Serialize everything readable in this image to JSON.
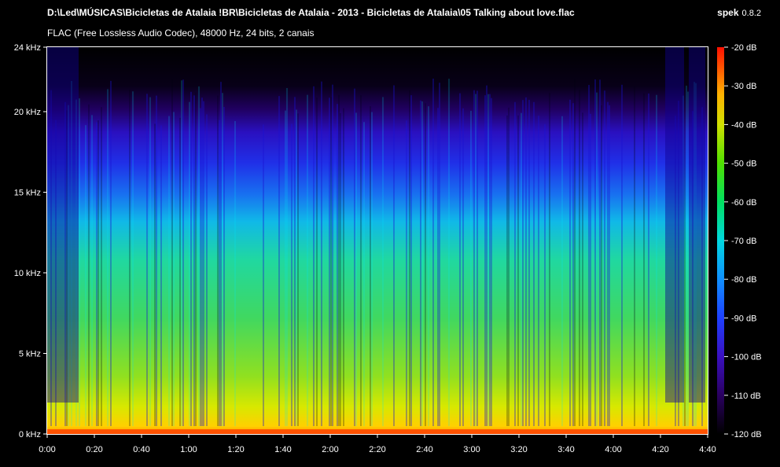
{
  "header": {
    "file_path": "D:\\Led\\MÚSICAS\\Bicicletas de Atalaia !BR\\Bicicletas de Atalaia - 2013 - Bicicletas de Atalaia\\05 Talking about love.flac",
    "file_info": "FLAC (Free Lossless Audio Codec), 48000 Hz, 24 bits, 2 canais",
    "app_name": "spek",
    "app_version": "0.8.2"
  },
  "colors": {
    "background": "#000000",
    "text": "#ffffff",
    "palette": [
      "#000000",
      "#1a0040",
      "#3a00a0",
      "#1e1ef0",
      "#00a8ff",
      "#00e0d0",
      "#30e030",
      "#c8e000",
      "#ffe000",
      "#ff8000",
      "#ff2000"
    ]
  },
  "spectrogram": {
    "freq_axis_labels": [
      "24 kHz",
      "20 kHz",
      "15 kHz",
      "10 kHz",
      "5 kHz",
      "0 kHz"
    ],
    "freq_axis_values_khz": [
      24,
      20,
      15,
      10,
      5,
      0
    ],
    "time_axis_labels": [
      "0:00",
      "0:20",
      "0:40",
      "1:00",
      "1:20",
      "1:40",
      "2:00",
      "2:20",
      "2:40",
      "3:00",
      "3:20",
      "3:40",
      "4:00",
      "4:20",
      "4:40"
    ],
    "time_axis_values_s": [
      0,
      20,
      40,
      60,
      80,
      100,
      120,
      140,
      160,
      180,
      200,
      220,
      240,
      260,
      280
    ],
    "freq_range_khz": [
      0,
      24
    ],
    "time_range_s": [
      0,
      280
    ]
  },
  "legend": {
    "db_labels": [
      "-20 dB",
      "-30 dB",
      "-40 dB",
      "-50 dB",
      "-60 dB",
      "-70 dB",
      "-80 dB",
      "-90 dB",
      "-100 dB",
      "-110 dB",
      "-120 dB"
    ],
    "db_values": [
      -20,
      -30,
      -40,
      -50,
      -60,
      -70,
      -80,
      -90,
      -100,
      -110,
      -120
    ],
    "range_db": [
      -120,
      -20
    ]
  }
}
